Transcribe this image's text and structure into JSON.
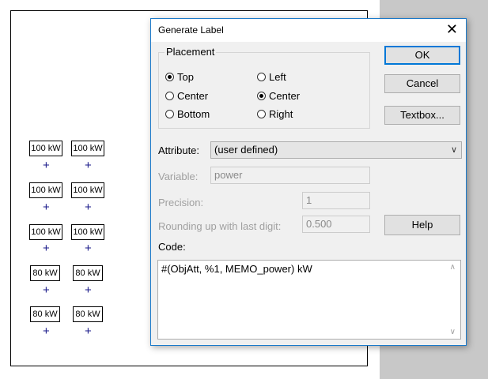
{
  "canvas": {
    "labels": [
      [
        "100 kW",
        "100 kW"
      ],
      [
        "100 kW",
        "100 kW"
      ],
      [
        "100 kW",
        "100 kW"
      ],
      [
        "80 kW",
        "80 kW"
      ],
      [
        "80 kW",
        "80 kW"
      ]
    ],
    "plus_symbol": "+"
  },
  "dialog": {
    "title": "Generate Label",
    "close_glyph": "✕",
    "placement": {
      "legend": "Placement",
      "vertical": [
        {
          "label": "Top",
          "checked": true
        },
        {
          "label": "Center",
          "checked": false
        },
        {
          "label": "Bottom",
          "checked": false
        }
      ],
      "horizontal": [
        {
          "label": "Left",
          "checked": false
        },
        {
          "label": "Center",
          "checked": true
        },
        {
          "label": "Right",
          "checked": false
        }
      ]
    },
    "buttons": {
      "ok": "OK",
      "cancel": "Cancel",
      "textbox": "Textbox...",
      "help": "Help"
    },
    "attribute": {
      "label": "Attribute:",
      "value": "(user defined)"
    },
    "variable": {
      "label": "Variable:",
      "value": "power"
    },
    "precision": {
      "label": "Precision:",
      "value": "1"
    },
    "rounding": {
      "label": "Rounding up with last digit:",
      "value": "0.500"
    },
    "code": {
      "label": "Code:",
      "value": "#(ObjAtt, %1, MEMO_power) kW"
    },
    "icons": {
      "dropdown": "chevron-down-icon",
      "close": "close-icon"
    }
  }
}
